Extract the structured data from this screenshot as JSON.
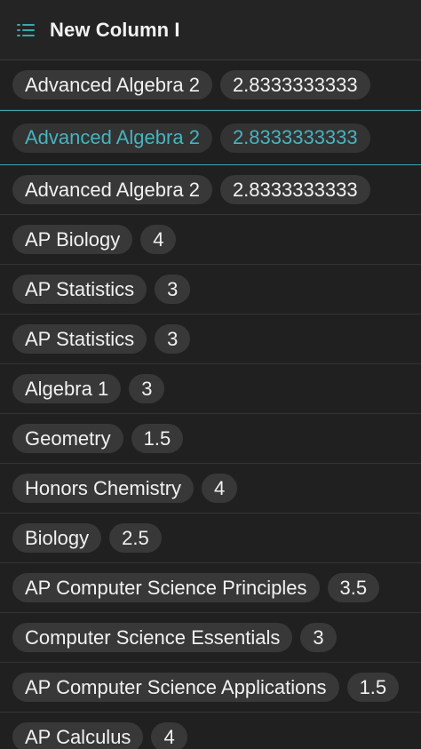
{
  "header": {
    "title": "New Column I",
    "icon": "list-icon",
    "accent_color": "#3aa7b3"
  },
  "rows": [
    {
      "course": "Advanced Algebra 2",
      "value": "2.8333333333"
    },
    {
      "course": "Advanced Algebra 2",
      "value": "2.8333333333",
      "selected": true
    },
    {
      "course": "Advanced Algebra 2",
      "value": "2.8333333333"
    },
    {
      "course": "AP Biology",
      "value": "4"
    },
    {
      "course": "AP Statistics",
      "value": "3"
    },
    {
      "course": "AP Statistics",
      "value": "3"
    },
    {
      "course": "Algebra 1",
      "value": "3"
    },
    {
      "course": "Geometry",
      "value": "1.5"
    },
    {
      "course": "Honors Chemistry",
      "value": "4"
    },
    {
      "course": "Biology",
      "value": "2.5"
    },
    {
      "course": "AP Computer Science Principles",
      "value": "3.5"
    },
    {
      "course": "Computer Science Essentials",
      "value": "3"
    },
    {
      "course": "AP Computer Science Applications",
      "value": "1.5"
    },
    {
      "course": "AP Calculus",
      "value": "4"
    }
  ]
}
